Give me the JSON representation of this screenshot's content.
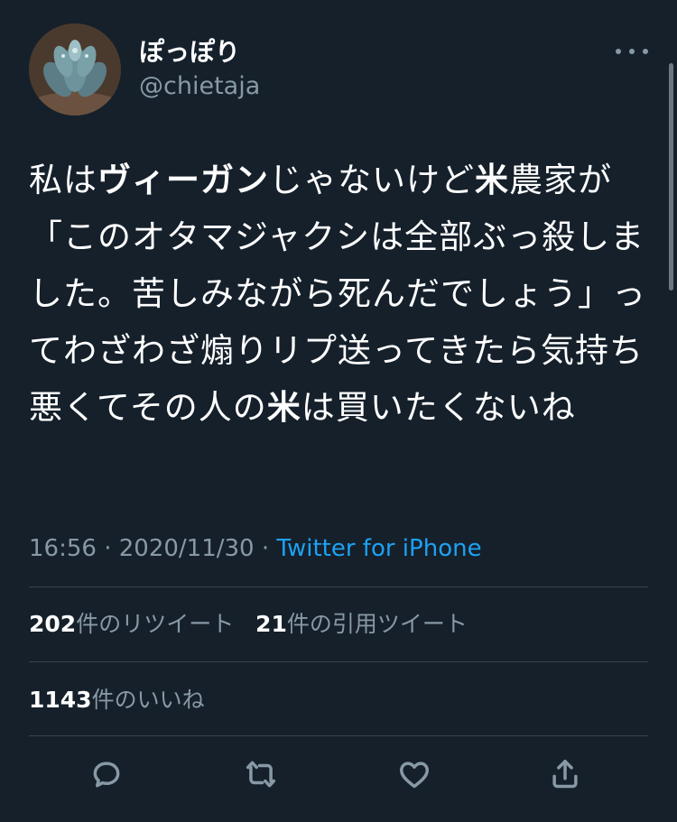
{
  "user": {
    "display_name": "ぽっぽり",
    "handle": "@chietaja"
  },
  "tweet": {
    "segments": [
      {
        "text": "私は",
        "bold": false
      },
      {
        "text": "ヴィーガン",
        "bold": true
      },
      {
        "text": "じゃないけど",
        "bold": false
      },
      {
        "text": "米",
        "bold": true
      },
      {
        "text": "農家が「このオタマジャクシは全部ぶっ殺しました。苦しみながら死んだでしょう」ってわざわざ煽りリプ送ってきたら気持ち悪くてその人の",
        "bold": false
      },
      {
        "text": "米",
        "bold": true
      },
      {
        "text": "は買いたくないね",
        "bold": false
      }
    ]
  },
  "meta": {
    "time": "16:56",
    "sep1": " · ",
    "date": "2020/11/30",
    "sep2": " · ",
    "source": "Twitter for iPhone"
  },
  "stats": {
    "retweets_count": "202",
    "retweets_label": "件のリツイート",
    "quotes_count": "21",
    "quotes_label": "件の引用ツイート",
    "likes_count": "1143",
    "likes_label": "件のいいね"
  },
  "icons": {
    "more": "more-options-icon",
    "reply": "reply-icon",
    "retweet": "retweet-icon",
    "like": "heart-icon",
    "share": "share-icon"
  },
  "colors": {
    "background": "#15202b",
    "secondary_text": "#8899a6",
    "link": "#1da1f2",
    "divider": "#38444d"
  }
}
